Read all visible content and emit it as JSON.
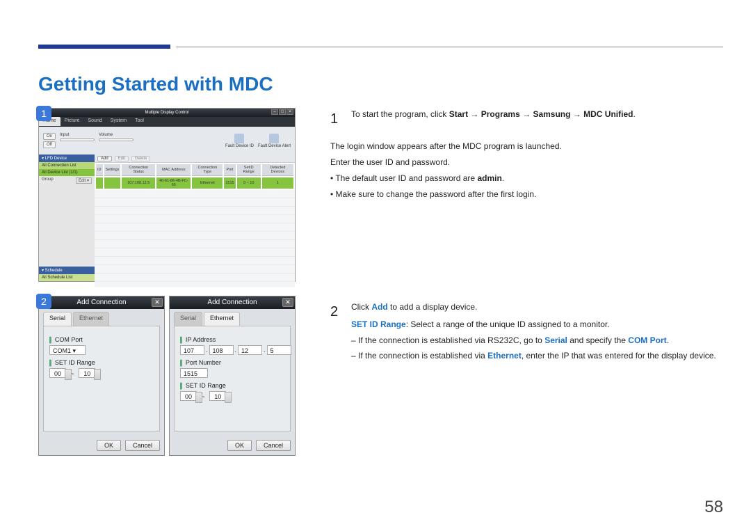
{
  "page": {
    "title": "Getting Started with MDC",
    "number": "58"
  },
  "step1": {
    "num": "1",
    "lead": "To start the program, click ",
    "path_start": "Start",
    "arrow": " → ",
    "path_programs": "Programs",
    "path_samsung": "Samsung",
    "path_mdc": "MDC Unified",
    "period": ".",
    "line2": "The login window appears after the MDC program is launched.",
    "line3": "Enter the user ID and password.",
    "bullet1a": "The default user ID and password are ",
    "bullet1b": "admin",
    "bullet1c": ".",
    "bullet2": "Make sure to change the password after the first login."
  },
  "step2": {
    "num": "2",
    "lead_a": "Click ",
    "lead_b": "Add",
    "lead_c": " to add a display device.",
    "line2_a": "SET ID Range",
    "line2_b": ": Select a range of the unique ID assigned to a monitor.",
    "dash1_a": "If the connection is established via RS232C, go to ",
    "dash1_b": "Serial",
    "dash1_c": " and specify the ",
    "dash1_d": "COM Port",
    "dash1_e": ".",
    "dash2_a": "If the connection is established via ",
    "dash2_b": "Ethernet",
    "dash2_c": ", enter the IP that was entered for the display device."
  },
  "mdc": {
    "badge": "1",
    "title": "Multiple Display Control",
    "menu": {
      "home": "Home",
      "picture": "Picture",
      "sound": "Sound",
      "system": "System",
      "tool": "Tool"
    },
    "toolbar": {
      "on": "On",
      "off": "Off",
      "input": "Input",
      "volume": "Volume",
      "fault_device_id": "Fault Device ID",
      "fault_device_alert": "Fault Device Alert"
    },
    "side": {
      "lfd": "▾ LFD Device",
      "all_conn": "All Connection List",
      "all_dev": "All Device List (1/1)",
      "group": "Group",
      "edit": "Edit ▾",
      "schedule": "▾ Schedule",
      "all_sched": "All Schedule List"
    },
    "devbar": {
      "add": "Add",
      "edit": "Edit",
      "delete": "Delete"
    },
    "table": {
      "h1": "ID",
      "h2": "Settings",
      "h3": "Connection Status",
      "h4": "MAC Address",
      "h5": "Connection Type",
      "h6": "Port",
      "h7": "SetID Range",
      "h8": "Detected Devices",
      "r1": "",
      "r2": "",
      "r3": "107.108.12.5",
      "r4": "40-61-86-4B-FC-65",
      "r5": "Ethernet",
      "r6": "1515",
      "r7": "0 ~ 10",
      "r8": "1"
    }
  },
  "dlg": {
    "badge": "2",
    "title": "Add Connection",
    "tabs": {
      "serial": "Serial",
      "ethernet": "Ethernet"
    },
    "serial": {
      "comport_label": "COM Port",
      "comport_value": "COM1 ▾",
      "setid_label": "SET ID Range",
      "from": "00",
      "to": "10"
    },
    "eth": {
      "ip_label": "IP Address",
      "ip1": "107",
      "ip2": "108",
      "ip3": "12",
      "ip4": "5",
      "port_label": "Port Number",
      "port_value": "1515",
      "setid_label": "SET ID Range",
      "from": "00",
      "to": "10"
    },
    "tilde": "~",
    "dot": ".",
    "ok": "OK",
    "cancel": "Cancel",
    "close": "✕"
  }
}
